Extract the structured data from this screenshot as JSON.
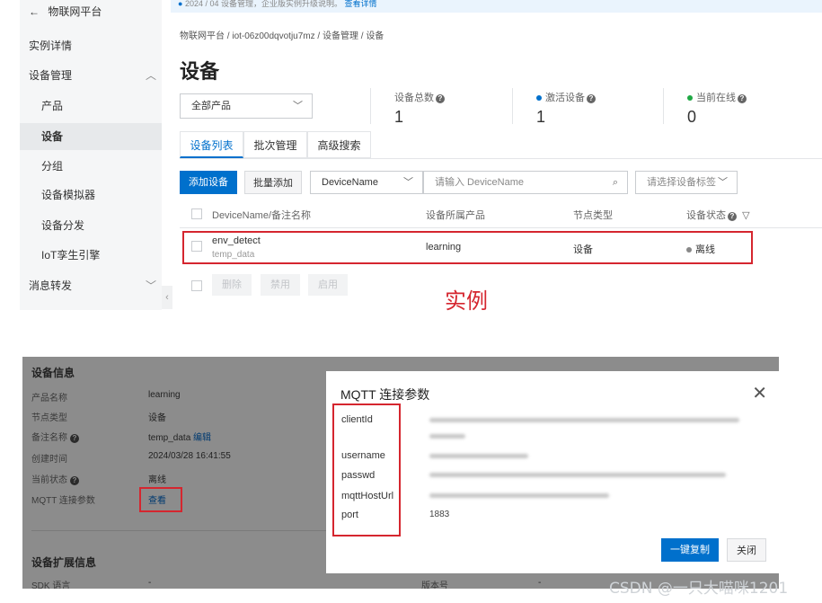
{
  "sidebar": {
    "back_label": "物联网平台",
    "items": [
      {
        "label": "实例详情"
      },
      {
        "label": "设备管理"
      },
      {
        "label": "产品"
      },
      {
        "label": "设备"
      },
      {
        "label": "分组"
      },
      {
        "label": "设备模拟器"
      },
      {
        "label": "设备分发"
      },
      {
        "label": "IoT孪生引擎"
      },
      {
        "label": "消息转发"
      }
    ]
  },
  "notice": {
    "text": "2024 / 04 设备管理，企业版实例升级说明。",
    "link": "查看详情"
  },
  "breadcrumb": [
    "物联网平台",
    "iot-06z00dqvotju7mz",
    "设备管理",
    "设备"
  ],
  "page": {
    "title": "设备"
  },
  "product_select": {
    "value": "全部产品"
  },
  "stats": [
    {
      "label": "设备总数",
      "value": "1",
      "dot": ""
    },
    {
      "label": "激活设备",
      "value": "1",
      "dot": "#0070cc"
    },
    {
      "label": "当前在线",
      "value": "0",
      "dot": "#1fa844"
    }
  ],
  "tabs": [
    {
      "label": "设备列表",
      "active": true
    },
    {
      "label": "批次管理"
    },
    {
      "label": "高级搜索"
    }
  ],
  "toolbar": {
    "add_device": "添加设备",
    "batch_add": "批量添加",
    "search_field": "DeviceName",
    "search_placeholder": "请输入 DeviceName",
    "tag_placeholder": "请选择设备标签"
  },
  "table": {
    "headers": [
      "DeviceName/备注名称",
      "设备所属产品",
      "节点类型",
      "设备状态"
    ],
    "rows": [
      {
        "name": "env_detect",
        "note": "temp_data",
        "product": "learning",
        "node_type": "设备",
        "status": "离线"
      }
    ],
    "batch_buttons": [
      "删除",
      "禁用",
      "启用"
    ]
  },
  "annotation": "实例",
  "device_info": {
    "title": "设备信息",
    "fields": [
      {
        "key": "产品名称",
        "value": "learning"
      },
      {
        "key": "节点类型",
        "value": "设备"
      },
      {
        "key": "备注名称",
        "value": "temp_data",
        "link": "编辑"
      },
      {
        "key": "创建时间",
        "value": "2024/03/28 16:41:55"
      },
      {
        "key": "当前状态",
        "value": "离线"
      },
      {
        "key": "MQTT 连接参数",
        "value": "查看"
      }
    ],
    "ext_title": "设备扩展信息",
    "ext_fields": [
      {
        "key": "SDK 语言",
        "value": "-"
      },
      {
        "key": "版本号",
        "value": "-"
      }
    ]
  },
  "modal": {
    "title": "MQTT 连接参数",
    "params": [
      {
        "key": "clientId",
        "value": ""
      },
      {
        "key": "username",
        "value": ""
      },
      {
        "key": "passwd",
        "value": ""
      },
      {
        "key": "mqttHostUrl",
        "value": ""
      },
      {
        "key": "port",
        "value": "1883"
      }
    ],
    "copy_button": "一键复制",
    "close_button": "关闭"
  },
  "watermark": "CSDN @一只大喵咪1201",
  "colors": {
    "accent": "#0070cc",
    "annotation_red": "#d5262f",
    "online_green": "#1fa844"
  }
}
